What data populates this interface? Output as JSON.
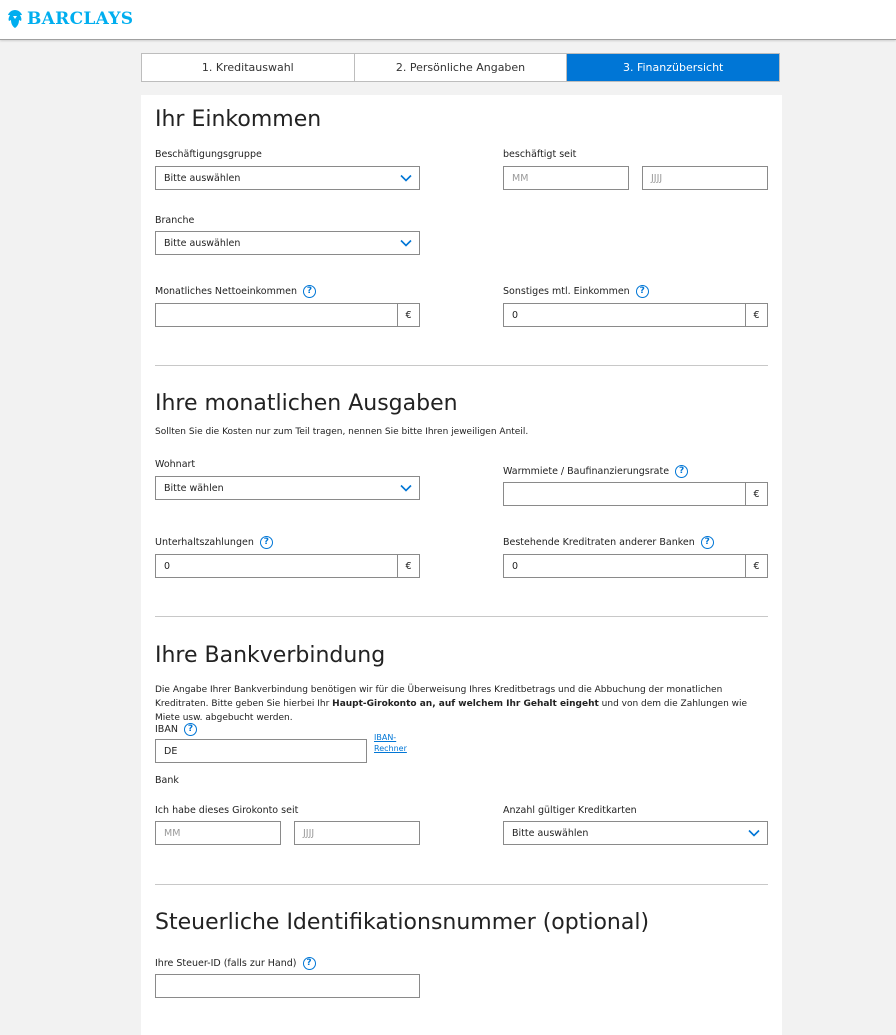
{
  "brand": {
    "name": "BARCLAYS",
    "color": "#00aeef"
  },
  "steps": [
    {
      "label": "1. Kreditauswahl"
    },
    {
      "label": "2. Persönliche Angaben"
    },
    {
      "label": "3. Finanzübersicht"
    }
  ],
  "income": {
    "title": "Ihr Einkommen",
    "employment_group_label": "Beschäftigungsgruppe",
    "employment_group_value": "Bitte auswählen",
    "employed_since_label": "beschäftigt seit",
    "month_placeholder": "MM",
    "year_placeholder": "JJJJ",
    "industry_label": "Branche",
    "industry_value": "Bitte auswählen",
    "net_income_label": "Monatliches Nettoeinkommen",
    "net_income_value": "",
    "other_income_label": "Sonstiges mtl. Einkommen",
    "other_income_value": "0",
    "currency": "€"
  },
  "expenses": {
    "title": "Ihre monatlichen Ausgaben",
    "note": "Sollten Sie die Kosten nur zum Teil tragen, nennen Sie bitte Ihren jeweiligen Anteil.",
    "housing_label": "Wohnart",
    "housing_value": "Bitte wählen",
    "rent_label": "Warmmiete / Baufinanzierungsrate",
    "rent_value": "",
    "alimony_label": "Unterhaltszahlungen",
    "alimony_value": "0",
    "loans_label": "Bestehende Kreditraten anderer Banken",
    "loans_value": "0",
    "currency": "€"
  },
  "bank": {
    "title": "Ihre Bankverbindung",
    "note_part1": "Die Angabe Ihrer Bankverbindung benötigen wir für die Überweisung Ihres Kreditbetrags und die Abbuchung der monatlichen Kreditraten. Bitte geben Sie hierbei Ihr ",
    "note_bold": "Haupt-Girokonto an, auf welchem Ihr Gehalt eingeht",
    "note_part2": " und von dem die Zahlungen wie Miete usw. abgebucht werden.",
    "iban_label": "IBAN",
    "iban_value": "DE",
    "iban_calc_link": "IBAN-Rechner",
    "bank_label": "Bank",
    "account_since_label": "Ich habe dieses Girokonto seit",
    "month_placeholder": "MM",
    "year_placeholder": "JJJJ",
    "cards_label": "Anzahl gültiger Kreditkarten",
    "cards_value": "Bitte auswählen"
  },
  "tax": {
    "title": "Steuerliche Identifikationsnummer (optional)",
    "tax_id_label": "Ihre Steuer-ID (falls zur Hand)",
    "tax_id_value": ""
  },
  "help_symbol": "?",
  "accent_color": "#0076d6"
}
